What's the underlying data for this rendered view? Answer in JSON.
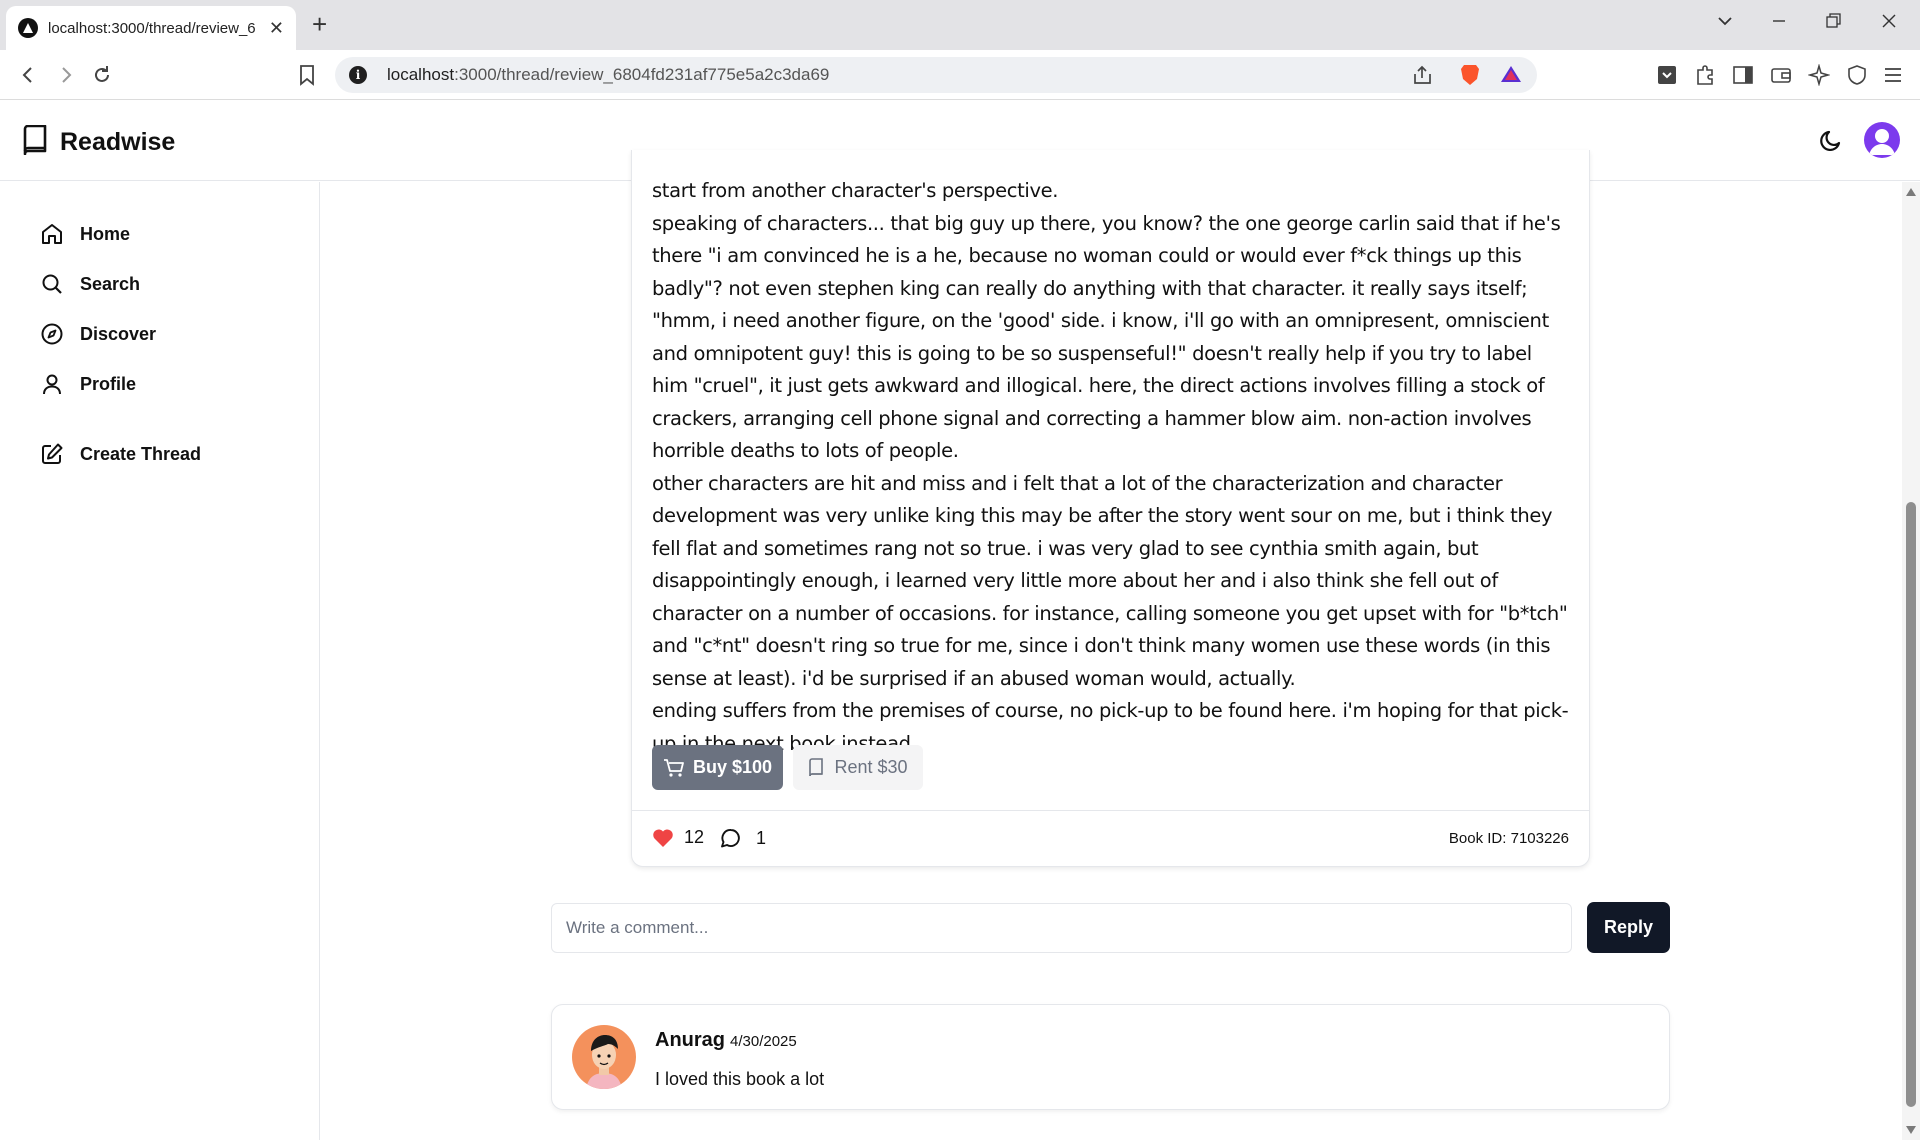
{
  "browser": {
    "tab_title": "localhost:3000/thread/review_6",
    "url_host": "localhost",
    "url_rest": ":3000/thread/review_6804fd231af775e5a2c3da69"
  },
  "app": {
    "brand": "Readwise"
  },
  "sidebar": {
    "items": [
      {
        "label": "Home",
        "icon": "home-icon"
      },
      {
        "label": "Search",
        "icon": "search-icon"
      },
      {
        "label": "Discover",
        "icon": "compass-icon"
      },
      {
        "label": "Profile",
        "icon": "user-icon"
      },
      {
        "label": "Create Thread",
        "icon": "edit-icon"
      }
    ]
  },
  "review": {
    "paragraphs": [
      "start from another character's perspective.",
      "speaking of characters... that big guy up there, you know? the one george carlin said that if he's there \"i am convinced he is a he, because no woman could or would ever f*ck things up this badly\"? not even stephen king can really do anything with that character. it really says itself; \"hmm, i need another figure, on the 'good' side. i know, i'll go with an omnipresent, omniscient and omnipotent guy! this is going to be so suspenseful!\" doesn't really help if you try to label him \"cruel\", it just gets awkward and illogical. here, the direct actions involves filling a stock of crackers, arranging cell phone signal and correcting a hammer blow aim. non-action involves horrible deaths to lots of people.",
      "other characters are hit and miss and i felt that a lot of the characterization and character development was very unlike king this may be after the story went sour on me, but i think they fell flat and sometimes rang not so true. i was very glad to see cynthia smith again, but disappointingly enough, i learned very little more about her and i also think she fell out of character on a number of occasions. for instance, calling someone you get upset with for \"b*tch\" and \"c*nt\" doesn't ring so true for me, since i don't think many women use these words (in this sense at least). i'd be surprised if an abused woman would, actually.",
      "ending suffers from the premises of course, no pick-up to be found here. i'm hoping for that pick-up in the next book instead."
    ],
    "buy_label": "Buy $100",
    "rent_label": "Rent $30",
    "likes": "12",
    "comments": "1",
    "book_id": "Book ID: 7103226"
  },
  "comment_form": {
    "placeholder": "Write a comment...",
    "reply_label": "Reply"
  },
  "comments": [
    {
      "author": "Anurag",
      "date": "4/30/2025",
      "text": "I loved this book a lot"
    }
  ],
  "colors": {
    "accent": "#111827",
    "like": "#ef4444",
    "avatar": "#7c3aed"
  }
}
